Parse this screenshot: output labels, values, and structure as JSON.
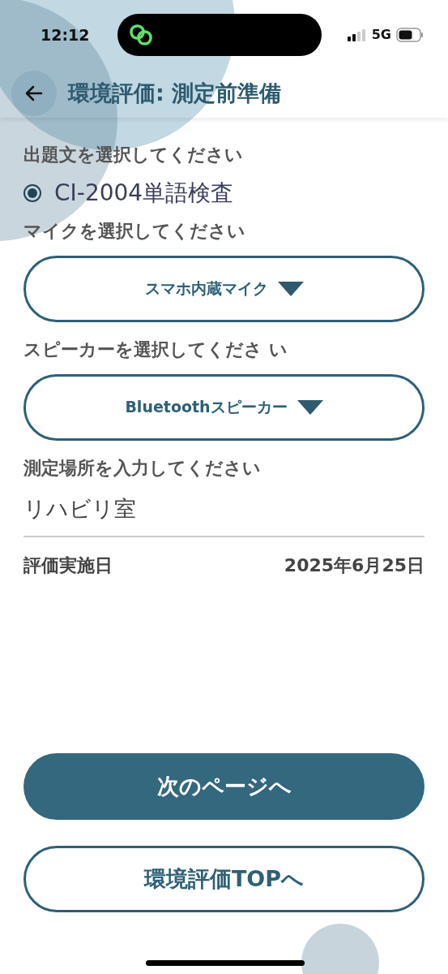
{
  "status_bar": {
    "time": "12:12",
    "network": "5G"
  },
  "header": {
    "title": "環境評価: 測定前準備"
  },
  "question": {
    "label": "出題文を選択してください",
    "options": [
      {
        "label": "CI-2004単語検査",
        "selected": true
      }
    ]
  },
  "microphone": {
    "label": "マイクを選択してください",
    "value": "スマホ内蔵マイク"
  },
  "speaker": {
    "label": "スピーカーを選択してくださ い",
    "value": "Bluetoothスピーカー"
  },
  "location": {
    "label": "測定場所を入力してください",
    "value": "リハビリ室"
  },
  "date": {
    "label": "評価実施日",
    "value": "2025年6月25日"
  },
  "buttons": [
    {
      "label": "次のページへ",
      "kind": "primary"
    },
    {
      "label": "環境評価TOPへ",
      "kind": "secondary"
    }
  ]
}
